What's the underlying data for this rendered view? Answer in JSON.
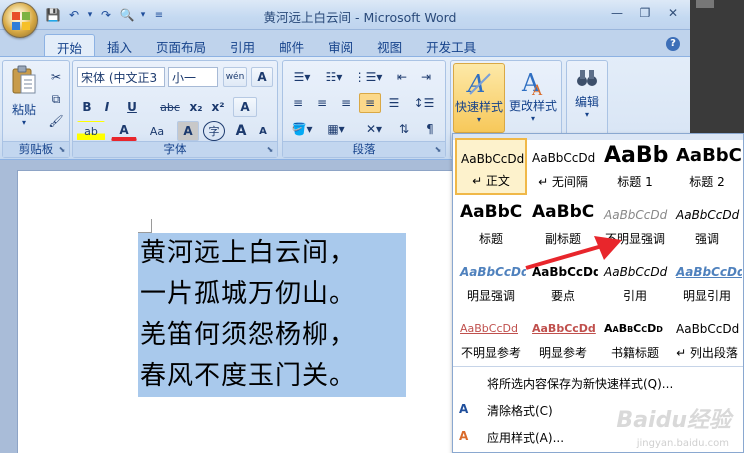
{
  "window": {
    "title": "黄河远上白云间 - Microsoft Word",
    "controls": [
      "—",
      "❐",
      "✕"
    ]
  },
  "qat": [
    "💾",
    "↶",
    "▾",
    "↷",
    "🔍",
    "▾",
    "≡"
  ],
  "tabs": [
    "开始",
    "插入",
    "页面布局",
    "引用",
    "邮件",
    "审阅",
    "视图",
    "开发工具"
  ],
  "ribbon": {
    "clipboard": {
      "paste": "粘贴",
      "label": "剪贴板"
    },
    "font": {
      "name": "宋体 (中文正3",
      "size": "小一",
      "wen": "wén",
      "a_box": "A",
      "bold": "B",
      "italic": "I",
      "underline": "U",
      "strike": "abc",
      "sub": "x₂",
      "sup": "x²",
      "clear": "A",
      "highlight": "ab",
      "color": "A",
      "case": "Aa",
      "shade": "A",
      "enclose": "字",
      "grow": "A",
      "shrink": "A",
      "label": "字体"
    },
    "paragraph": {
      "label": "段落"
    },
    "styles": {
      "quick": "快速样式",
      "change": "更改样式"
    },
    "editing": {
      "label": "编辑"
    }
  },
  "document": {
    "lines": [
      "黄河远上白云间，",
      "一片孤城万仞山。",
      "羌笛何须怨杨柳，",
      "春风不度玉门关。"
    ]
  },
  "gallery": {
    "tiles": [
      {
        "sample": "AaBbCcDd",
        "label": "↵ 正文"
      },
      {
        "sample": "AaBbCcDd",
        "label": "↵ 无间隔"
      },
      {
        "sample": "AaBb",
        "label": "标题 1"
      },
      {
        "sample": "AaBbC",
        "label": "标题 2"
      },
      {
        "sample": "AaBbC",
        "label": "标题"
      },
      {
        "sample": "AaBbC",
        "label": "副标题"
      },
      {
        "sample": "AaBbCcDd",
        "label": "不明显强调"
      },
      {
        "sample": "AaBbCcDd",
        "label": "强调"
      },
      {
        "sample": "AaBbCcDd",
        "label": "明显强调"
      },
      {
        "sample": "AaBbCcDd",
        "label": "要点"
      },
      {
        "sample": "AaBbCcDd",
        "label": "引用"
      },
      {
        "sample": "AaBbCcDd",
        "label": "明显引用"
      },
      {
        "sample": "AaBbCcDd",
        "label": "不明显参考"
      },
      {
        "sample": "AaBbCcDd",
        "label": "明显参考"
      },
      {
        "sample": "AaBbCcDd",
        "label": "书籍标题"
      },
      {
        "sample": "AaBbCcDd",
        "label": "↵ 列出段落"
      }
    ],
    "menu": [
      {
        "icon": "",
        "label": "将所选内容保存为新快速样式(Q)..."
      },
      {
        "icon": "A",
        "label": "清除格式(C)"
      },
      {
        "icon": "A",
        "label": "应用样式(A)..."
      }
    ]
  },
  "watermark": {
    "brand": "Baidu经验",
    "url": "jingyan.baidu.com"
  },
  "colors": {
    "accent": "#15428b",
    "highlight_red": "#e8262c",
    "selection": "#a9c9ec"
  }
}
